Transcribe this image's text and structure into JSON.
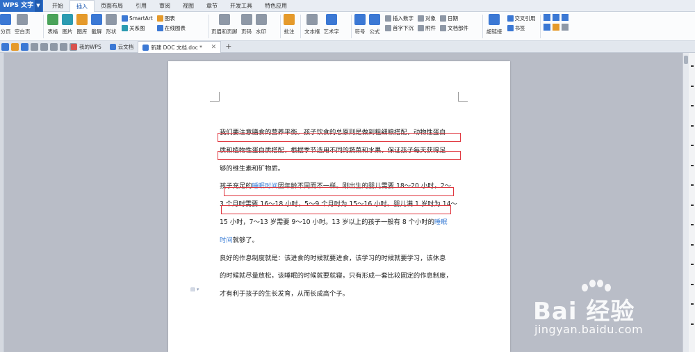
{
  "app": {
    "name": "WPS 文字"
  },
  "menu": {
    "tabs": [
      "开始",
      "插入",
      "页面布局",
      "引用",
      "审阅",
      "视图",
      "章节",
      "开发工具",
      "特色应用"
    ]
  },
  "ribbon": {
    "page_break": "分页",
    "blank_page": "空白页",
    "table": "表格",
    "picture": "图片",
    "gallery": "图库",
    "screenshot": "截屏",
    "shapes": "形状",
    "smartart": "SmartArt",
    "chart": "图表",
    "relation_chart": "关系图",
    "online_chart": "在线图表",
    "header_footer": "页眉和页脚",
    "page_number": "页码",
    "watermark": "水印",
    "comment": "批注",
    "textbox": "文本框",
    "wordart": "艺术字",
    "symbol": "符号",
    "formula": "公式",
    "insert_number": "插入数字",
    "object": "对象",
    "date": "日期",
    "drop_cap": "首字下沉",
    "attachment": "附件",
    "doc_parts": "文档部件",
    "hyperlink": "超链接",
    "cross_ref": "交叉引用",
    "bookmark": "书签"
  },
  "doc_tabs": [
    {
      "label": "我的WPS"
    },
    {
      "label": "云文档"
    },
    {
      "label": "新建 DOC 文档.doc *"
    }
  ],
  "document": {
    "p1": [
      "我们要注意膳食的营养平衡。孩子饮食的总原则是做到粗细粮搭配，动物性蛋白",
      "质和植物性蛋白质搭配，根据季节选用不同的蔬菜和水果，保证孩子每天获得足",
      "够的维生素和矿物质。"
    ],
    "p2": {
      "l1_pre": "孩子充足的",
      "l1_kw": "睡眠时间",
      "l1_post": "因年龄不同而不一样。刚出生的婴儿需要 18～20 小时，2～",
      "l2": "3 个月时需要 16～18 小时，5～9 个月时为 15～16 小时。婴儿满 1 岁时为 14～",
      "l3_pre": "15 小时，7～13 岁需要 9～10 小时。13 岁以上的孩子一般有 8 个小时的",
      "l3_kw": "睡眠",
      "l4_kw": "时间",
      "l4_post": "就够了。"
    },
    "p3": [
      "良好的作息制度就是：该进食的时候就要进食，该学习的时候就要学习，该休息",
      "的时候就尽量放松，该睡眠的时候就要就寝，只有形成一套比较固定的作息制度，",
      "才有利于孩子的生长发育，从而长成高个子。"
    ]
  },
  "watermark": {
    "brand": "Bai 经验",
    "url": "jingyan.baidu.com"
  }
}
